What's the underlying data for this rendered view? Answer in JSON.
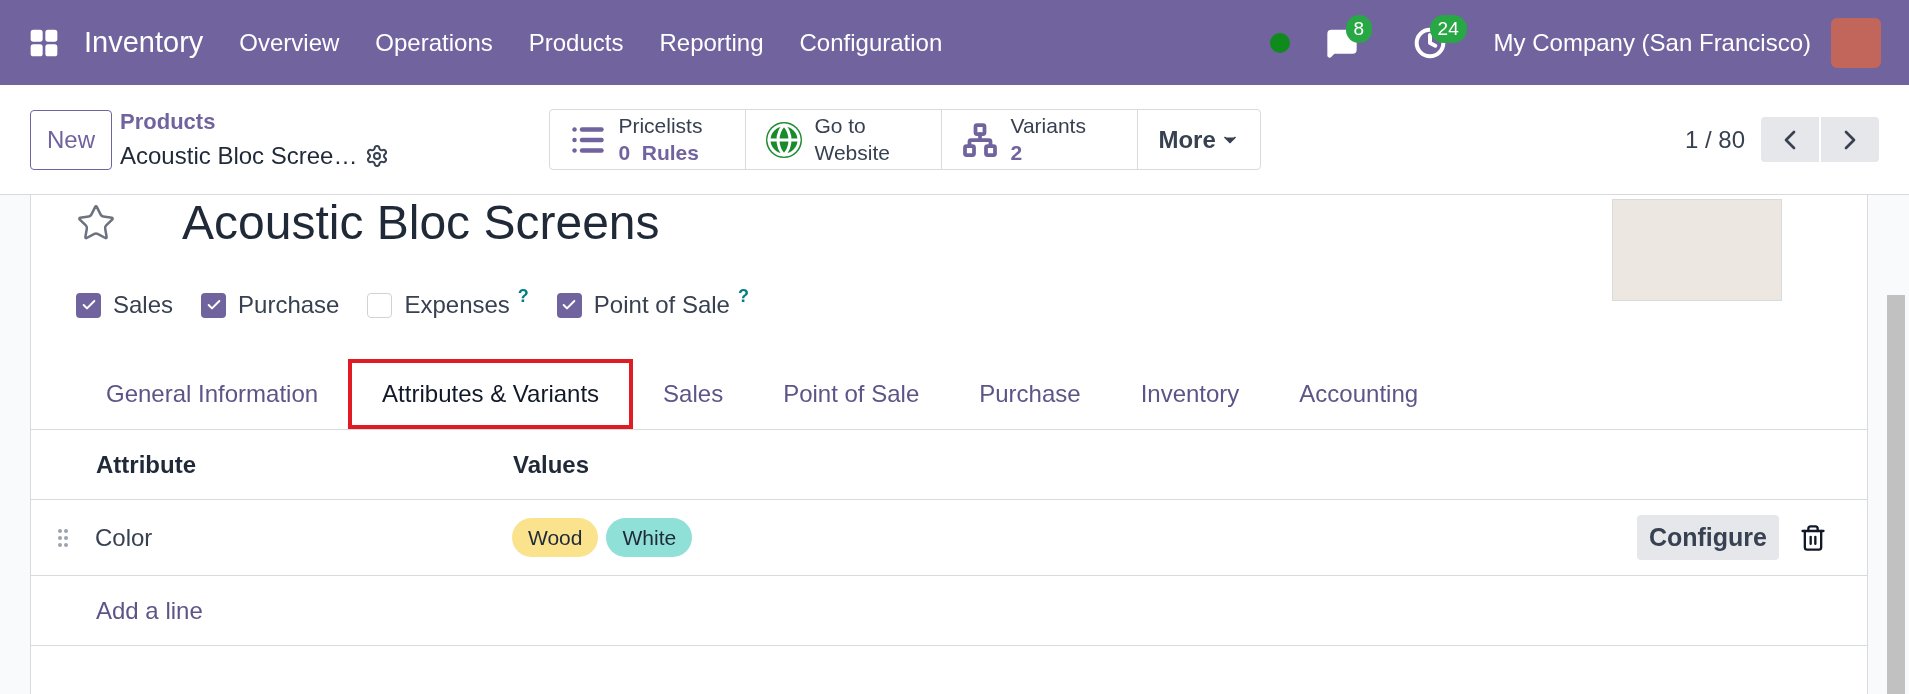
{
  "navbar": {
    "app": "Inventory",
    "menu": [
      "Overview",
      "Operations",
      "Products",
      "Reporting",
      "Configuration"
    ],
    "messages_count": "8",
    "activities_count": "24",
    "company": "My Company (San Francisco)"
  },
  "control_panel": {
    "new_button": "New",
    "breadcrumb": "Products",
    "record_name": "Acoustic Bloc Scree…",
    "smart_buttons": [
      {
        "kind": "pricelist",
        "label": "Pricelists",
        "value": "0  Rules"
      },
      {
        "kind": "globe",
        "label": "Go to",
        "value": "Website"
      },
      {
        "kind": "variants",
        "label": "Variants",
        "value": "2"
      }
    ],
    "more": "More",
    "pager": "1 / 80"
  },
  "product": {
    "name": "Acoustic Bloc Screens",
    "favorite": false,
    "options": [
      {
        "label": "Sales",
        "checked": true
      },
      {
        "label": "Purchase",
        "checked": true
      },
      {
        "label": "Expenses",
        "checked": false,
        "help": "?"
      },
      {
        "label": "Point of Sale",
        "checked": true,
        "help": "?"
      }
    ]
  },
  "tabs": [
    {
      "label": "General Information",
      "selected": false
    },
    {
      "label": "Attributes & Variants",
      "selected": true
    },
    {
      "label": "Sales",
      "selected": false
    },
    {
      "label": "Point of Sale",
      "selected": false
    },
    {
      "label": "Purchase",
      "selected": false
    },
    {
      "label": "Inventory",
      "selected": false
    },
    {
      "label": "Accounting",
      "selected": false
    }
  ],
  "table": {
    "columns": [
      "Attribute",
      "Values"
    ],
    "rows": [
      {
        "attribute": "Color",
        "values": [
          {
            "label": "Wood",
            "color": "#fbe38e"
          },
          {
            "label": "White",
            "color": "#8fe0d7"
          }
        ],
        "action": "Configure"
      }
    ],
    "add_line": "Add a line"
  }
}
